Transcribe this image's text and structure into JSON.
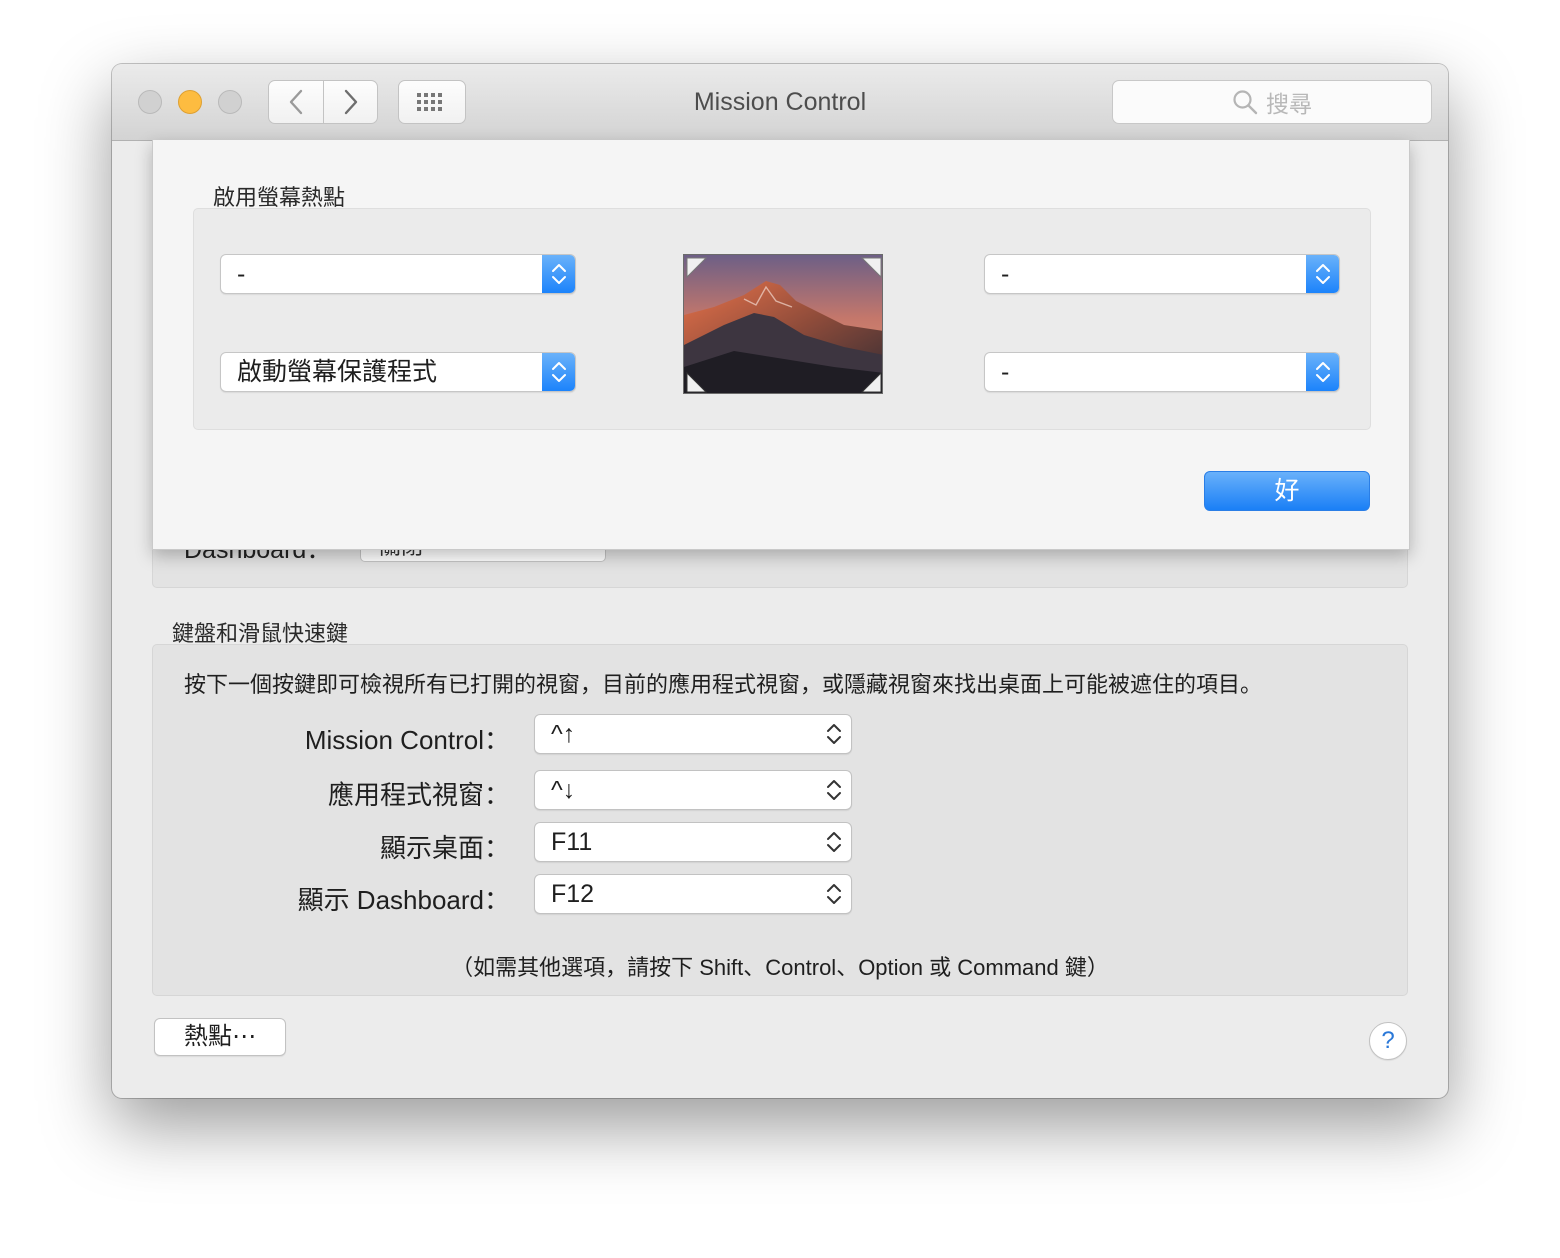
{
  "window": {
    "title": "Mission Control"
  },
  "search": {
    "placeholder": "搜尋"
  },
  "hot_corners_sheet": {
    "title": "啟用螢幕熱點",
    "top_left": "-",
    "top_right": "-",
    "bottom_left": "啟動螢幕保護程式",
    "bottom_right": "-",
    "ok_label": "好"
  },
  "background": {
    "dashboard_label": "Dashboard：",
    "dashboard_value": "關閉"
  },
  "keyboard": {
    "section_title": "鍵盤和滑鼠快速鍵",
    "description": "按下一個按鍵即可檢視所有已打開的視窗，目前的應用程式視窗，或隱藏視窗來找出桌面上可能被遮住的項目。",
    "rows": [
      {
        "label": "Mission Control：",
        "value": "^↑"
      },
      {
        "label": "應用程式視窗：",
        "value": "^↓"
      },
      {
        "label": "顯示桌面：",
        "value": "F11"
      },
      {
        "label": "顯示 Dashboard：",
        "value": "F12"
      }
    ],
    "note": "（如需其他選項，請按下 Shift、Control、Option 或 Command 鍵）"
  },
  "footer": {
    "hot_corners_button": "熱點⋯",
    "help_button": "?"
  },
  "icons": {
    "traffic_close": "close-light",
    "traffic_minimize": "minimize-light",
    "traffic_zoom": "zoom-light",
    "nav_back": "chevron-left-icon",
    "nav_forward": "chevron-right-icon",
    "show_all": "grid-icon",
    "search": "search-icon"
  },
  "colors": {
    "accent": "#1a82fb",
    "minimize": "#fdbc40"
  }
}
